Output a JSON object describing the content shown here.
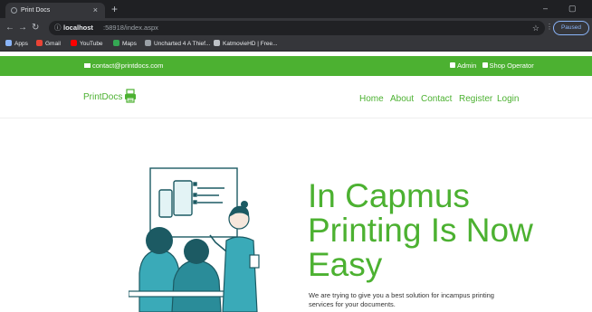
{
  "browser": {
    "tab_title": "Print Docs",
    "tab_close": "×",
    "new_tab": "+",
    "win_minimize": "–",
    "win_maximize": "▢",
    "url_host": "localhost",
    "url_path": ":58918/index.aspx",
    "profile_label": "Paused",
    "bookmarks": [
      {
        "label": "Apps",
        "icon": "apps-grid-icon",
        "color": "#8ab4f8"
      },
      {
        "label": "Gmail",
        "icon": "gmail-icon",
        "color": "#ea4335"
      },
      {
        "label": "YouTube",
        "icon": "youtube-icon",
        "color": "#ff0000"
      },
      {
        "label": "Maps",
        "icon": "maps-icon",
        "color": "#34a853"
      },
      {
        "label": "Uncharted 4 A Thief...",
        "icon": "page-icon",
        "color": "#9aa0a6"
      },
      {
        "label": "KatmovieHD | Free...",
        "icon": "katmovie-icon",
        "color": "#bdc1c6"
      }
    ]
  },
  "site": {
    "colors": {
      "brand_green": "#4cb131"
    },
    "topbar": {
      "email": "contact@printdocs.com",
      "admin": "Admin",
      "shop_operator": "Shop Operator"
    },
    "brand": "PrintDocs",
    "nav": [
      "Home",
      "About",
      "Contact",
      "Register",
      "Login"
    ],
    "hero": {
      "title_lines": [
        "In Capmus",
        "Printing Is Now",
        "Easy"
      ],
      "subtitle_lines": [
        "We are trying to give you a best solution for incampus printing",
        "services for your documents."
      ]
    }
  }
}
